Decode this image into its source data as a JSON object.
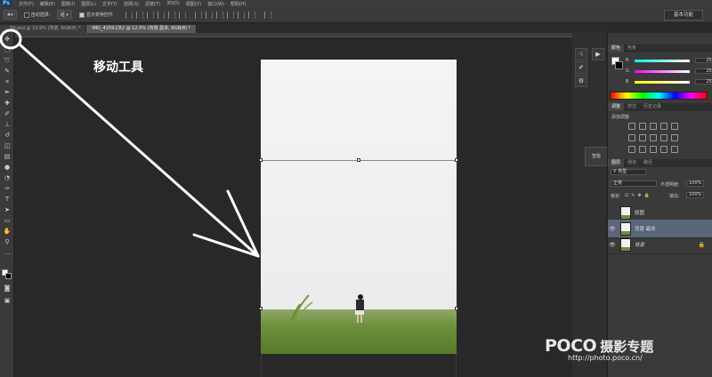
{
  "menubar": {
    "logo": "Ps",
    "items": [
      "文件(F)",
      "编辑(E)",
      "图像(I)",
      "图层(L)",
      "文字(Y)",
      "选择(S)",
      "滤镜(T)",
      "3D(D)",
      "视图(V)",
      "窗口(W)",
      "帮助(H)"
    ]
  },
  "options": {
    "auto_select_label": "自动选择：",
    "auto_select_value": "组",
    "show_transform_label": "显示变换控件",
    "workspace": "基本功能"
  },
  "tabs": [
    {
      "label": "…59.psd @ 13.9% (背景, RGB/8) *",
      "active": false
    },
    {
      "label": "IMG_4159.CR2 @ 12.5% (背景 副本, RGB/8) *",
      "active": true
    }
  ],
  "annotation": {
    "text": "移动工具"
  },
  "dock": {
    "popout": "智能"
  },
  "panels": {
    "color_tabs": [
      "颜色",
      "色板"
    ],
    "rgb": [
      {
        "channel": "R",
        "value": "255",
        "color": "#ff4040"
      },
      {
        "channel": "G",
        "value": "255",
        "color": "#40c040"
      },
      {
        "channel": "B",
        "value": "255",
        "color": "#4060ff"
      }
    ],
    "adjust_tabs": [
      "调整",
      "样式",
      "历史记录"
    ],
    "adjust_title": "添加调整",
    "layers_tabs": [
      "图层",
      "通道",
      "路径"
    ],
    "kind_label": "类型",
    "blend_mode": "正常",
    "opacity_label": "不透明度:",
    "opacity_value": "100%",
    "lock_label": "锁定:",
    "fill_label": "填充:",
    "fill_value": "100%",
    "layers": [
      {
        "name": "原图",
        "visible": false,
        "selected": false,
        "locked": false
      },
      {
        "name": "背景 副本",
        "visible": true,
        "selected": true,
        "locked": false
      },
      {
        "name": "背景",
        "visible": true,
        "selected": false,
        "locked": true
      }
    ]
  },
  "watermark": {
    "logo": "POCO",
    "title": "摄影专题",
    "url": "http://photo.poco.cn/"
  }
}
